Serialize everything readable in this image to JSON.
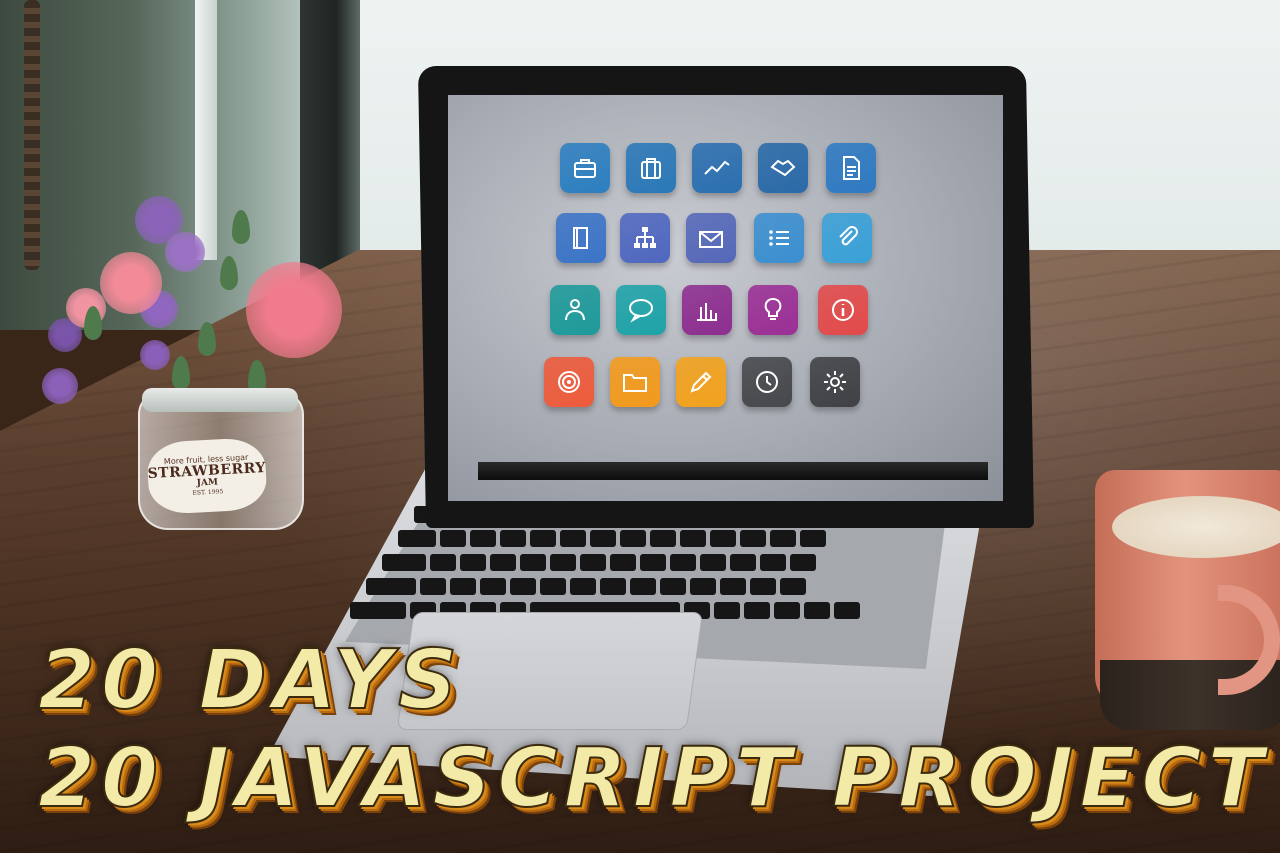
{
  "title": {
    "line1": "20 DAYS",
    "line2": "20 JAVASCRIPT PROJECT"
  },
  "jar_label": {
    "tagline": "More fruit, less sugar",
    "main": "STRAWBERRY",
    "sub": "JAM",
    "est": "EST. 1995"
  },
  "screen_icons": [
    {
      "name": "briefcase-icon",
      "color": "#2d7fc0"
    },
    {
      "name": "suitcase-icon",
      "color": "#2a78b8"
    },
    {
      "name": "line-chart-icon",
      "color": "#2b6fb0"
    },
    {
      "name": "handshake-icon",
      "color": "#2a6aa8"
    },
    {
      "name": "document-icon",
      "color": "#2f7ac2"
    },
    {
      "name": "notebook-icon",
      "color": "#3b74c7"
    },
    {
      "name": "org-chart-icon",
      "color": "#4f67c0"
    },
    {
      "name": "mail-icon",
      "color": "#5568b9"
    },
    {
      "name": "list-icon",
      "color": "#3b8fd0"
    },
    {
      "name": "paperclip-icon",
      "color": "#3aa1d8"
    },
    {
      "name": "users-icon",
      "color": "#1e9a9a"
    },
    {
      "name": "chat-bubble-icon",
      "color": "#1ea3a8"
    },
    {
      "name": "bar-chart-icon",
      "color": "#8d2e8f"
    },
    {
      "name": "lightbulb-icon",
      "color": "#9b2f95"
    },
    {
      "name": "info-icon",
      "color": "#e34a4a"
    },
    {
      "name": "target-icon",
      "color": "#ee5b3b"
    },
    {
      "name": "folder-icon",
      "color": "#f39a1c"
    },
    {
      "name": "pencil-icon",
      "color": "#f3a21c"
    },
    {
      "name": "clock-icon",
      "color": "#46484c"
    },
    {
      "name": "gear-icon",
      "color": "#3f4145"
    }
  ]
}
